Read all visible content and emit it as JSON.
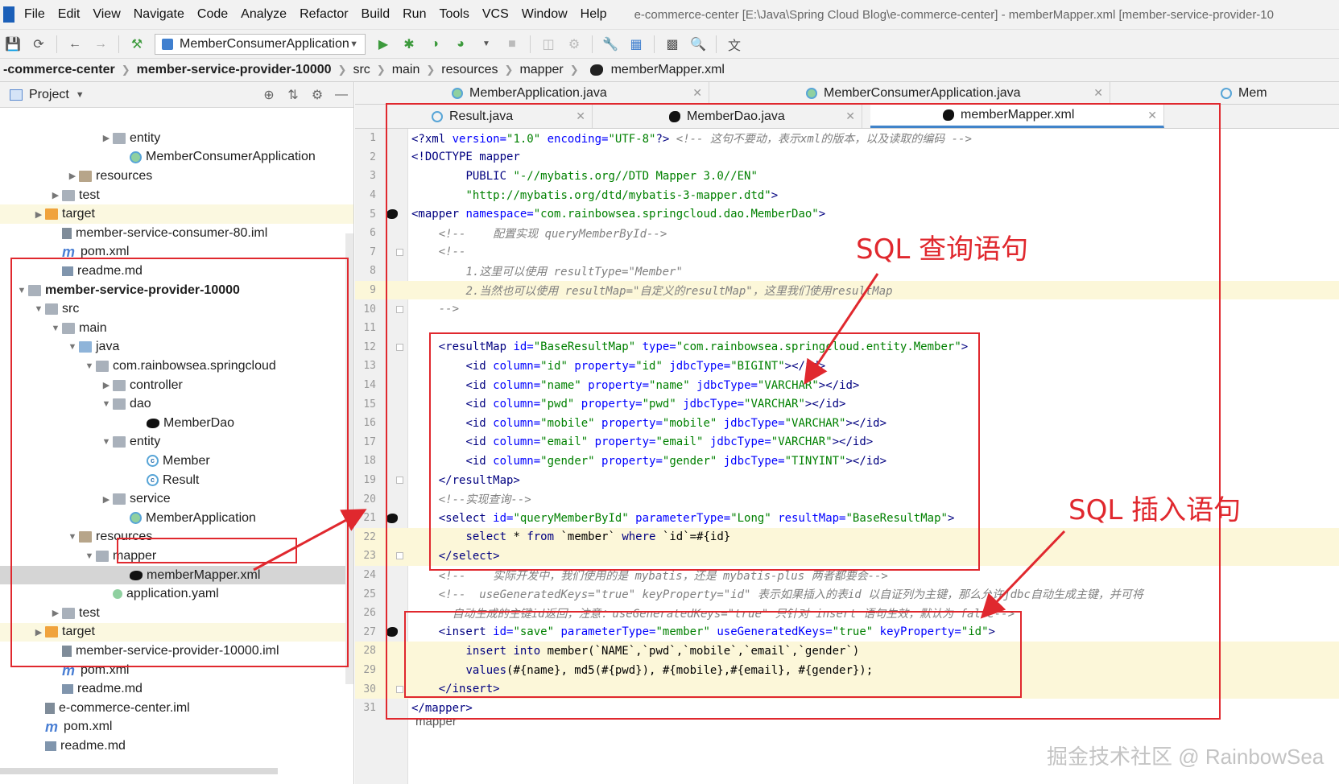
{
  "menubar": {
    "items": [
      "File",
      "Edit",
      "View",
      "Navigate",
      "Code",
      "Analyze",
      "Refactor",
      "Build",
      "Run",
      "Tools",
      "VCS",
      "Window",
      "Help"
    ],
    "window_title": "e-commerce-center [E:\\Java\\Spring Cloud Blog\\e-commerce-center] - memberMapper.xml [member-service-provider-10"
  },
  "toolbar": {
    "run_config": "MemberConsumerApplication"
  },
  "breadcrumb": {
    "items": [
      "-commerce-center",
      "member-service-provider-10000",
      "src",
      "main",
      "resources",
      "mapper",
      "memberMapper.xml"
    ]
  },
  "project_panel": {
    "title": "Project",
    "rows": [
      {
        "indent": 6,
        "arrow": "▶",
        "icon": "pkg",
        "label": "entity"
      },
      {
        "indent": 7,
        "arrow": "",
        "icon": "app",
        "label": "MemberConsumerApplication"
      },
      {
        "indent": 4,
        "arrow": "▶",
        "icon": "res",
        "label": "resources"
      },
      {
        "indent": 3,
        "arrow": "▶",
        "icon": "folder",
        "label": "test"
      },
      {
        "indent": 2,
        "arrow": "▶",
        "icon": "orange",
        "label": "target",
        "yellow": true
      },
      {
        "indent": 3,
        "arrow": "",
        "icon": "iml",
        "label": "member-service-consumer-80.iml"
      },
      {
        "indent": 3,
        "arrow": "",
        "icon": "pom",
        "label": "pom.xml"
      },
      {
        "indent": 3,
        "arrow": "",
        "icon": "md",
        "label": "readme.md"
      },
      {
        "indent": 1,
        "arrow": "▼",
        "icon": "folder",
        "label": "member-service-provider-10000",
        "bold": true
      },
      {
        "indent": 2,
        "arrow": "▼",
        "icon": "folder",
        "label": "src"
      },
      {
        "indent": 3,
        "arrow": "▼",
        "icon": "folder",
        "label": "main"
      },
      {
        "indent": 4,
        "arrow": "▼",
        "icon": "src",
        "label": "java"
      },
      {
        "indent": 5,
        "arrow": "▼",
        "icon": "pkg",
        "label": "com.rainbowsea.springcloud"
      },
      {
        "indent": 6,
        "arrow": "▶",
        "icon": "pkg",
        "label": "controller"
      },
      {
        "indent": 6,
        "arrow": "▼",
        "icon": "pkg",
        "label": "dao"
      },
      {
        "indent": 8,
        "arrow": "",
        "icon": "bird",
        "label": "MemberDao"
      },
      {
        "indent": 6,
        "arrow": "▼",
        "icon": "pkg",
        "label": "entity"
      },
      {
        "indent": 8,
        "arrow": "",
        "icon": "cls",
        "label": "Member"
      },
      {
        "indent": 8,
        "arrow": "",
        "icon": "cls",
        "label": "Result"
      },
      {
        "indent": 6,
        "arrow": "▶",
        "icon": "pkg",
        "label": "service"
      },
      {
        "indent": 7,
        "arrow": "",
        "icon": "app",
        "label": "MemberApplication"
      },
      {
        "indent": 4,
        "arrow": "▼",
        "icon": "res",
        "label": "resources"
      },
      {
        "indent": 5,
        "arrow": "▼",
        "icon": "folder",
        "label": "mapper"
      },
      {
        "indent": 7,
        "arrow": "",
        "icon": "bird",
        "label": "memberMapper.xml",
        "selected": true
      },
      {
        "indent": 6,
        "arrow": "",
        "icon": "yaml",
        "label": "application.yaml"
      },
      {
        "indent": 3,
        "arrow": "▶",
        "icon": "folder",
        "label": "test"
      },
      {
        "indent": 2,
        "arrow": "▶",
        "icon": "orange",
        "label": "target",
        "yellow": true
      },
      {
        "indent": 3,
        "arrow": "",
        "icon": "iml",
        "label": "member-service-provider-10000.iml"
      },
      {
        "indent": 3,
        "arrow": "",
        "icon": "pom",
        "label": "pom.xml"
      },
      {
        "indent": 3,
        "arrow": "",
        "icon": "md",
        "label": "readme.md"
      },
      {
        "indent": 2,
        "arrow": "",
        "icon": "iml",
        "label": "e-commerce-center.iml"
      },
      {
        "indent": 2,
        "arrow": "",
        "icon": "pom",
        "label": "pom.xml"
      },
      {
        "indent": 2,
        "arrow": "",
        "icon": "md",
        "label": "readme.md"
      }
    ]
  },
  "tabs_row1": [
    {
      "label": "MemberApplication.java",
      "icon": "app"
    },
    {
      "label": "MemberConsumerApplication.java",
      "icon": "app"
    },
    {
      "label": "Mem",
      "icon": "cls"
    }
  ],
  "tabs_row2": [
    {
      "label": "Result.java",
      "icon": "cls",
      "active": false
    },
    {
      "label": "MemberDao.java",
      "icon": "bird",
      "active": false
    },
    {
      "label": "memberMapper.xml",
      "icon": "bird",
      "active": true
    }
  ],
  "editor": {
    "lines": [
      {
        "n": "1",
        "segs": [
          [
            "tag",
            "<?xml "
          ],
          [
            "attr",
            "version="
          ],
          [
            "str",
            "\"1.0\" "
          ],
          [
            "attr",
            "encoding="
          ],
          [
            "str",
            "\"UTF-8\""
          ],
          [
            "tag",
            "?> "
          ],
          [
            "com",
            "<!-- 这句不要动，表示xml的版本，以及读取的编码 -->"
          ]
        ]
      },
      {
        "n": "2",
        "segs": [
          [
            "tag",
            "<!DOCTYPE mapper"
          ]
        ]
      },
      {
        "n": "3",
        "segs": [
          [
            "plain",
            "        "
          ],
          [
            "tag",
            "PUBLIC "
          ],
          [
            "str",
            "\"-//mybatis.org//DTD Mapper 3.0//EN\""
          ]
        ]
      },
      {
        "n": "4",
        "segs": [
          [
            "plain",
            "        "
          ],
          [
            "str",
            "\"http://mybatis.org/dtd/mybatis-3-mapper.dtd\""
          ],
          [
            "tag",
            ">"
          ]
        ]
      },
      {
        "n": "5",
        "mark": "bird",
        "segs": [
          [
            "tag",
            "<mapper "
          ],
          [
            "attr",
            "namespace="
          ],
          [
            "str",
            "\"com.rainbowsea.springcloud.dao.MemberDao\""
          ],
          [
            "tag",
            ">"
          ]
        ]
      },
      {
        "n": "6",
        "segs": [
          [
            "plain",
            "    "
          ],
          [
            "com",
            "<!--    配置实现 queryMemberById-->"
          ]
        ]
      },
      {
        "n": "7",
        "mark": "fold",
        "segs": [
          [
            "plain",
            "    "
          ],
          [
            "com",
            "<!--"
          ]
        ]
      },
      {
        "n": "8",
        "segs": [
          [
            "plain",
            "        "
          ],
          [
            "com",
            "1.这里可以使用 resultType=\"Member\""
          ]
        ]
      },
      {
        "n": "9",
        "hl": true,
        "segs": [
          [
            "plain",
            "        "
          ],
          [
            "com",
            "2.当然也可以使用 resultMap=\"自定义的resultMap\"，这里我们使用resultMap"
          ]
        ]
      },
      {
        "n": "10",
        "mark": "fold",
        "segs": [
          [
            "plain",
            "    "
          ],
          [
            "com",
            "-->"
          ]
        ]
      },
      {
        "n": "11",
        "segs": []
      },
      {
        "n": "12",
        "mark": "fold",
        "segs": [
          [
            "plain",
            "    "
          ],
          [
            "tag",
            "<resultMap "
          ],
          [
            "attr",
            "id="
          ],
          [
            "str",
            "\"BaseResultMap\" "
          ],
          [
            "attr",
            "type="
          ],
          [
            "str",
            "\"com.rainbowsea.springcloud.entity.Member\""
          ],
          [
            "tag",
            ">"
          ]
        ]
      },
      {
        "n": "13",
        "segs": [
          [
            "plain",
            "        "
          ],
          [
            "tag",
            "<id "
          ],
          [
            "attr",
            "column="
          ],
          [
            "str",
            "\"id\" "
          ],
          [
            "attr",
            "property="
          ],
          [
            "str",
            "\"id\" "
          ],
          [
            "attr",
            "jdbcType="
          ],
          [
            "str",
            "\"BIGINT\""
          ],
          [
            "tag",
            "></id>"
          ]
        ]
      },
      {
        "n": "14",
        "segs": [
          [
            "plain",
            "        "
          ],
          [
            "tag",
            "<id "
          ],
          [
            "attr",
            "column="
          ],
          [
            "str",
            "\"name\" "
          ],
          [
            "attr",
            "property="
          ],
          [
            "str",
            "\"name\" "
          ],
          [
            "attr",
            "jdbcType="
          ],
          [
            "str",
            "\"VARCHAR\""
          ],
          [
            "tag",
            "></id>"
          ]
        ]
      },
      {
        "n": "15",
        "segs": [
          [
            "plain",
            "        "
          ],
          [
            "tag",
            "<id "
          ],
          [
            "attr",
            "column="
          ],
          [
            "str",
            "\"pwd\" "
          ],
          [
            "attr",
            "property="
          ],
          [
            "str",
            "\"pwd\" "
          ],
          [
            "attr",
            "jdbcType="
          ],
          [
            "str",
            "\"VARCHAR\""
          ],
          [
            "tag",
            "></id>"
          ]
        ]
      },
      {
        "n": "16",
        "segs": [
          [
            "plain",
            "        "
          ],
          [
            "tag",
            "<id "
          ],
          [
            "attr",
            "column="
          ],
          [
            "str",
            "\"mobile\" "
          ],
          [
            "attr",
            "property="
          ],
          [
            "str",
            "\"mobile\" "
          ],
          [
            "attr",
            "jdbcType="
          ],
          [
            "str",
            "\"VARCHAR\""
          ],
          [
            "tag",
            "></id>"
          ]
        ]
      },
      {
        "n": "17",
        "segs": [
          [
            "plain",
            "        "
          ],
          [
            "tag",
            "<id "
          ],
          [
            "attr",
            "column="
          ],
          [
            "str",
            "\"email\" "
          ],
          [
            "attr",
            "property="
          ],
          [
            "str",
            "\"email\" "
          ],
          [
            "attr",
            "jdbcType="
          ],
          [
            "str",
            "\"VARCHAR\""
          ],
          [
            "tag",
            "></id>"
          ]
        ]
      },
      {
        "n": "18",
        "segs": [
          [
            "plain",
            "        "
          ],
          [
            "tag",
            "<id "
          ],
          [
            "attr",
            "column="
          ],
          [
            "str",
            "\"gender\" "
          ],
          [
            "attr",
            "property="
          ],
          [
            "str",
            "\"gender\" "
          ],
          [
            "attr",
            "jdbcType="
          ],
          [
            "str",
            "\"TINYINT\""
          ],
          [
            "tag",
            "></id>"
          ]
        ]
      },
      {
        "n": "19",
        "mark": "fold",
        "segs": [
          [
            "plain",
            "    "
          ],
          [
            "tag",
            "</resultMap>"
          ]
        ]
      },
      {
        "n": "20",
        "segs": [
          [
            "plain",
            "    "
          ],
          [
            "com",
            "<!--实现查询-->"
          ]
        ]
      },
      {
        "n": "21",
        "mark": "bird",
        "segs": [
          [
            "plain",
            "    "
          ],
          [
            "tag",
            "<select "
          ],
          [
            "attr",
            "id="
          ],
          [
            "str",
            "\"queryMemberById\" "
          ],
          [
            "attr",
            "parameterType="
          ],
          [
            "str",
            "\"Long\" "
          ],
          [
            "attr",
            "resultMap="
          ],
          [
            "str",
            "\"BaseResultMap\""
          ],
          [
            "tag",
            ">"
          ]
        ]
      },
      {
        "n": "22",
        "hl": true,
        "segs": [
          [
            "plain",
            "        "
          ],
          [
            "kw",
            "select "
          ],
          [
            "plain",
            "* "
          ],
          [
            "kw",
            "from "
          ],
          [
            "plain",
            "`member` "
          ],
          [
            "kw",
            "where "
          ],
          [
            "plain",
            "`id`=#{id}"
          ]
        ]
      },
      {
        "n": "23",
        "hl": true,
        "mark": "fold",
        "segs": [
          [
            "plain",
            "    "
          ],
          [
            "tag",
            "</select>"
          ]
        ]
      },
      {
        "n": "24",
        "segs": [
          [
            "plain",
            "    "
          ],
          [
            "com",
            "<!--    实际开发中，我们使用的是 mybatis，还是 mybatis-plus 两者都要会-->"
          ]
        ]
      },
      {
        "n": "25",
        "segs": [
          [
            "plain",
            "    "
          ],
          [
            "com",
            "<!--  useGeneratedKeys=\"true\" keyProperty=\"id\" 表示如果插入的表id 以自证列为主键，那么允许jdbc自动生成主键，并可将"
          ]
        ]
      },
      {
        "n": "26",
        "segs": [
          [
            "plain",
            "      "
          ],
          [
            "com",
            "自动生成的主键id返回，注意：useGeneratedKeys=\"true\" 只针对 insert 语句生效，默认为 false-->"
          ]
        ]
      },
      {
        "n": "27",
        "mark": "bird",
        "segs": [
          [
            "plain",
            "    "
          ],
          [
            "tag",
            "<insert "
          ],
          [
            "attr",
            "id="
          ],
          [
            "str",
            "\"save\" "
          ],
          [
            "attr",
            "parameterType="
          ],
          [
            "str",
            "\"member\" "
          ],
          [
            "attr",
            "useGeneratedKeys="
          ],
          [
            "str",
            "\"true\" "
          ],
          [
            "attr",
            "keyProperty="
          ],
          [
            "str",
            "\"id\""
          ],
          [
            "tag",
            ">"
          ]
        ]
      },
      {
        "n": "28",
        "hl": true,
        "segs": [
          [
            "plain",
            "        "
          ],
          [
            "kw",
            "insert into "
          ],
          [
            "plain",
            "member(`NAME`,`pwd`,`mobile`,`email`,`gender`)"
          ]
        ]
      },
      {
        "n": "29",
        "hl": true,
        "segs": [
          [
            "plain",
            "        "
          ],
          [
            "kw",
            "values"
          ],
          [
            "plain",
            "(#{name}, md5(#{pwd}), #{mobile},#{email}, #{gender});"
          ]
        ]
      },
      {
        "n": "30",
        "hl": true,
        "mark": "fold",
        "segs": [
          [
            "plain",
            "    "
          ],
          [
            "tag",
            "</insert>"
          ]
        ]
      },
      {
        "n": "31",
        "segs": [
          [
            "tag",
            "</mapper>"
          ]
        ]
      }
    ],
    "footer_crumb": "mapper"
  },
  "annotations": {
    "query_label": "SQL 查询语句",
    "insert_label": "SQL 插入语句",
    "color": "#e0282e"
  },
  "watermark": "掘金技术社区 @ RainbowSea"
}
